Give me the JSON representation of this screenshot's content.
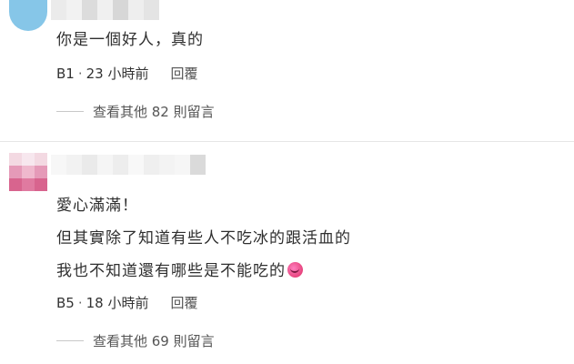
{
  "comments": [
    {
      "text_lines": [
        "你是一個好人，真的"
      ],
      "floor": "B1",
      "dot": "·",
      "time": "23 小時前",
      "reply_label": "回覆",
      "more_label": "查看其他 82 則留言",
      "avatar_color": "#86c6e8",
      "name_blur_colors": [
        "#ebebeb",
        "#f2f2f2",
        "#dcdcdc",
        "#f0f0f0",
        "#d7d7d7",
        "#eeeeee",
        "#e4e4e4"
      ]
    },
    {
      "text_lines": [
        "愛心滿滿！",
        "但其實除了知道有些人不吃冰的跟活血的",
        "我也不知道還有哪些是不能吃的"
      ],
      "emoji_icon": "rolling-laughing-emoji-icon",
      "floor": "B5",
      "dot": "·",
      "time": "18 小時前",
      "reply_label": "回覆",
      "more_label": "查看其他 69 則留言",
      "avatar_colors": [
        "#f3d9e2",
        "#e59ab8",
        "#d8648e"
      ],
      "name_blur_colors": [
        "#f5f5f5",
        "#e2e2e2",
        "#d0d0d0",
        "#dedede",
        "#c9c9c9",
        "#e4e4e4",
        "#f0f0f0",
        "#d6d6d6",
        "#eeeeee",
        "#dadada"
      ]
    }
  ]
}
